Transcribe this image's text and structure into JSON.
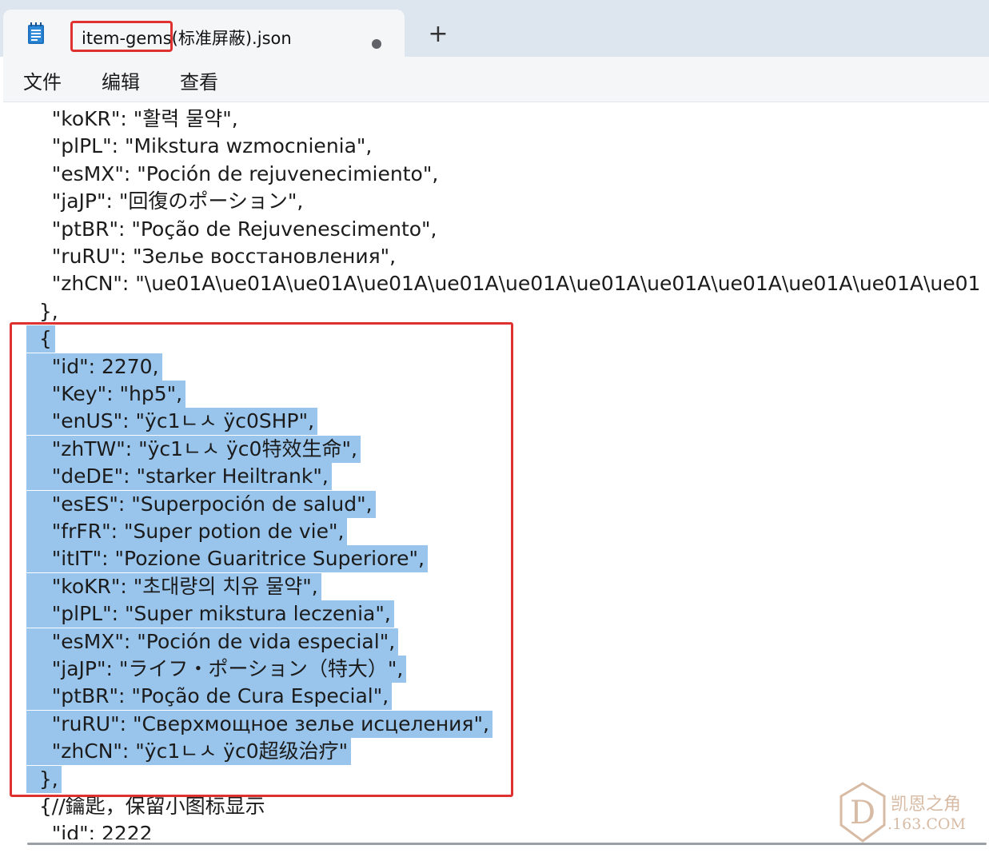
{
  "window": {
    "tab": {
      "title": "item-gems(标准屏蔽).json",
      "unsaved": true
    },
    "new_tab_label": "+",
    "app_icon": "notepad-icon"
  },
  "menu": {
    "file": "文件",
    "edit": "编辑",
    "view": "查看"
  },
  "editor": {
    "lines": [
      "    \"koKR\": \"활력 물약\",",
      "    \"plPL\": \"Mikstura wzmocnienia\",",
      "    \"esMX\": \"Poción de rejuvenecimiento\",",
      "    \"jaJP\": \"回復のポーション\",",
      "    \"ptBR\": \"Poção de Rejuvenescimento\",",
      "    \"ruRU\": \"Зелье восстановления\",",
      "    \"zhCN\": \"\\ue01A\\ue01A\\ue01A\\ue01A\\ue01A\\ue01A\\ue01A\\ue01A\\ue01A\\ue01A\\ue01A\\ue01",
      "  },",
      "  {",
      "    \"id\": 2270,",
      "    \"Key\": \"hp5\",",
      "    \"enUS\": \"ÿc1ㄴㅅ ÿc0SHP\",",
      "    \"zhTW\": \"ÿc1ㄴㅅ ÿc0特效生命\",",
      "    \"deDE\": \"starker Heiltrank\",",
      "    \"esES\": \"Superpoción de salud\",",
      "    \"frFR\": \"Super potion de vie\",",
      "    \"itIT\": \"Pozione Guaritrice Superiore\",",
      "    \"koKR\": \"초대량의 치유 물약\",",
      "    \"plPL\": \"Super mikstura leczenia\",",
      "    \"esMX\": \"Poción de vida especial\",",
      "    \"jaJP\": \"ライフ・ポーション（特大）\",",
      "    \"ptBR\": \"Poção de Cura Especial\",",
      "    \"ruRU\": \"Сверхмощное зелье исцеления\",",
      "    \"zhCN\": \"ÿc1ㄴㅅ ÿc0超级治疗\"",
      "  },",
      "  {//鑰匙，保留小图标显示",
      "    \"id\": 2222"
    ],
    "selection": {
      "first_line": 8,
      "last_line": 24
    }
  },
  "watermark": {
    "text_line1": "凯恩之角",
    "text_line2": ".163.COM",
    "logo_letter": "D"
  },
  "colors": {
    "selection": "#99c5ec",
    "highlight_border": "#e03131",
    "titlebar": "#dde5ef"
  }
}
